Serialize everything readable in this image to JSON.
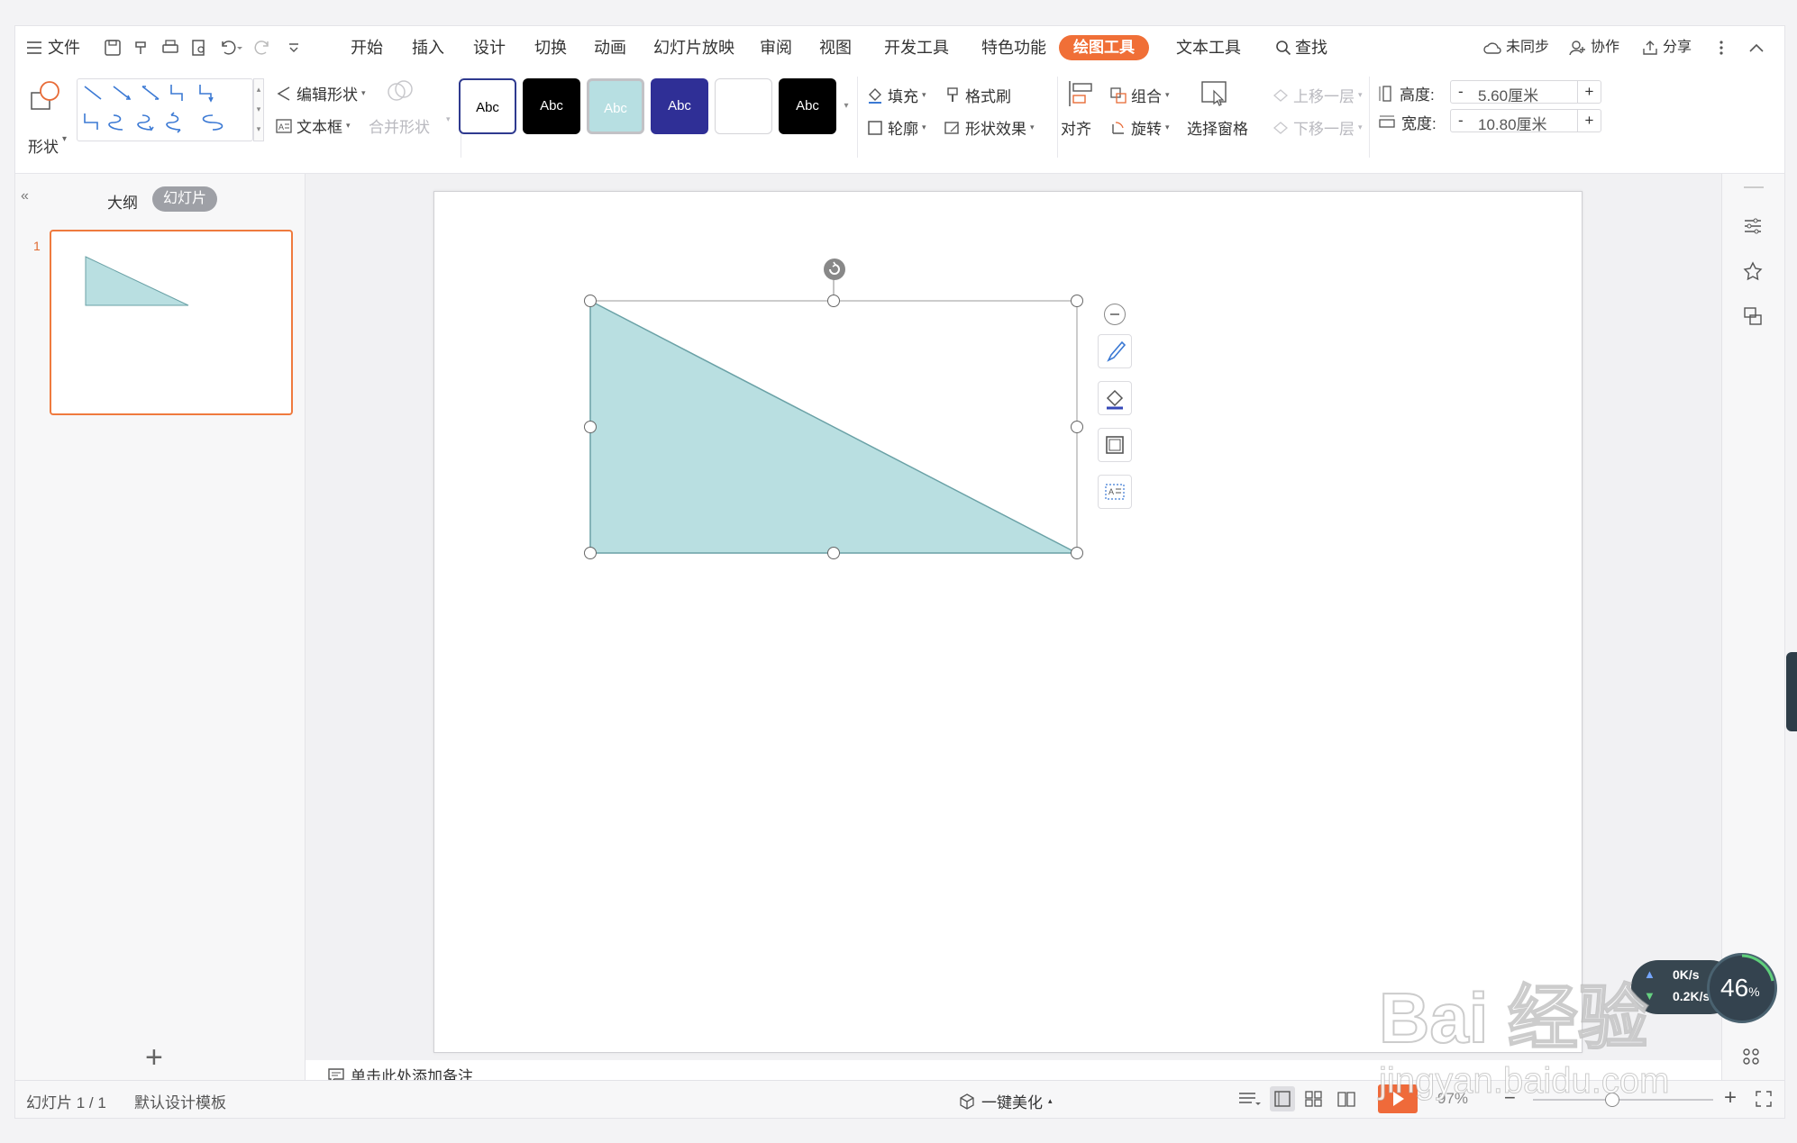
{
  "menubar": {
    "file_label": "文件",
    "tabs": [
      "开始",
      "插入",
      "设计",
      "切换",
      "动画",
      "幻灯片放映",
      "审阅",
      "视图",
      "开发工具",
      "特色功能",
      "绘图工具",
      "文本工具"
    ],
    "active_tab": "绘图工具",
    "search_label": "查找",
    "sync_label": "未同步",
    "collab_label": "协作",
    "share_label": "分享"
  },
  "ribbon": {
    "shape_label": "形状",
    "edit_shape_label": "编辑形状",
    "textbox_label": "文本框",
    "merge_shape_label": "合并形状",
    "style_samples": [
      "Abc",
      "Abc",
      "Abc",
      "Abc",
      "",
      "Abc"
    ],
    "fill_label": "填充",
    "format_painter_label": "格式刷",
    "outline_label": "轮廓",
    "shape_effect_label": "形状效果",
    "align_label": "对齐",
    "group_label": "组合",
    "rotate_label": "旋转",
    "selection_pane_label": "选择窗格",
    "bring_forward_label": "上移一层",
    "send_backward_label": "下移一层",
    "height_label": "高度:",
    "height_value": "5.60厘米",
    "width_label": "宽度:",
    "width_value": "10.80厘米",
    "minus": "-",
    "plus": "+"
  },
  "left_panel": {
    "outline_tab": "大纲",
    "slides_tab": "幻灯片",
    "slide_number": "1",
    "collapse_icon": "double-chevron-left-icon"
  },
  "notes": {
    "placeholder": "单击此处添加备注"
  },
  "statusbar": {
    "slide_counter": "幻灯片 1 / 1",
    "template": "默认设计模板",
    "beautify_label": "一键美化",
    "zoom": "97%"
  },
  "overlay": {
    "upload_speed": "0K/s",
    "download_speed": "0.2K/s",
    "percent": "46",
    "percent_unit": "%"
  },
  "watermark": {
    "brand": "Bai 经验",
    "url": "jingyan.baidu.com"
  },
  "colors": {
    "accent": "#f06f37",
    "triangle_fill": "#b9dfe1",
    "triangle_stroke": "#6aa1a6"
  }
}
